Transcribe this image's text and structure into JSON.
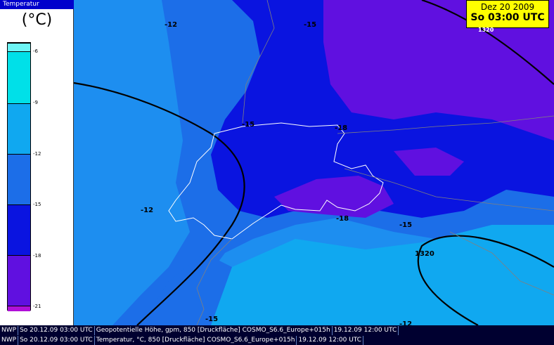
{
  "legend": {
    "title": "Temperatur",
    "unit": "(°C)",
    "bands": [
      {
        "color": "#6ef5f5"
      },
      {
        "color": "#00e0e8"
      },
      {
        "color": "#10a8f0"
      },
      {
        "color": "#1c6ee8"
      },
      {
        "color": "#0a14e0"
      },
      {
        "color": "#6010e0"
      },
      {
        "color": "#b010d8"
      }
    ],
    "ticks": [
      "-6",
      "-9",
      "-12",
      "-15",
      "-18",
      "-21"
    ]
  },
  "datebox": {
    "date": "Dez 20 2009",
    "time": "So 03:00 UTC"
  },
  "map_labels": [
    {
      "text": "-12"
    },
    {
      "text": "-15"
    },
    {
      "text": "-15"
    },
    {
      "text": "-18"
    },
    {
      "text": "-12"
    },
    {
      "text": "-18"
    },
    {
      "text": "-15"
    },
    {
      "text": "1320"
    },
    {
      "text": "-15"
    },
    {
      "text": "-12"
    },
    {
      "text": "1320"
    }
  ],
  "footer": {
    "row1": [
      "NWP",
      "So 20.12.09 03:00 UTC",
      "Geopotentielle Höhe, gpm, 850 [Druckfläche] COSMO_S6.6_Europe+015h",
      "19.12.09 12:00 UTC"
    ],
    "row2": [
      "NWP",
      "So 20.12.09 03:00 UTC",
      "Temperatur, °C, 850 [Druckfläche] COSMO_S6.6_Europe+015h",
      "19.12.09 12:00 UTC"
    ]
  }
}
